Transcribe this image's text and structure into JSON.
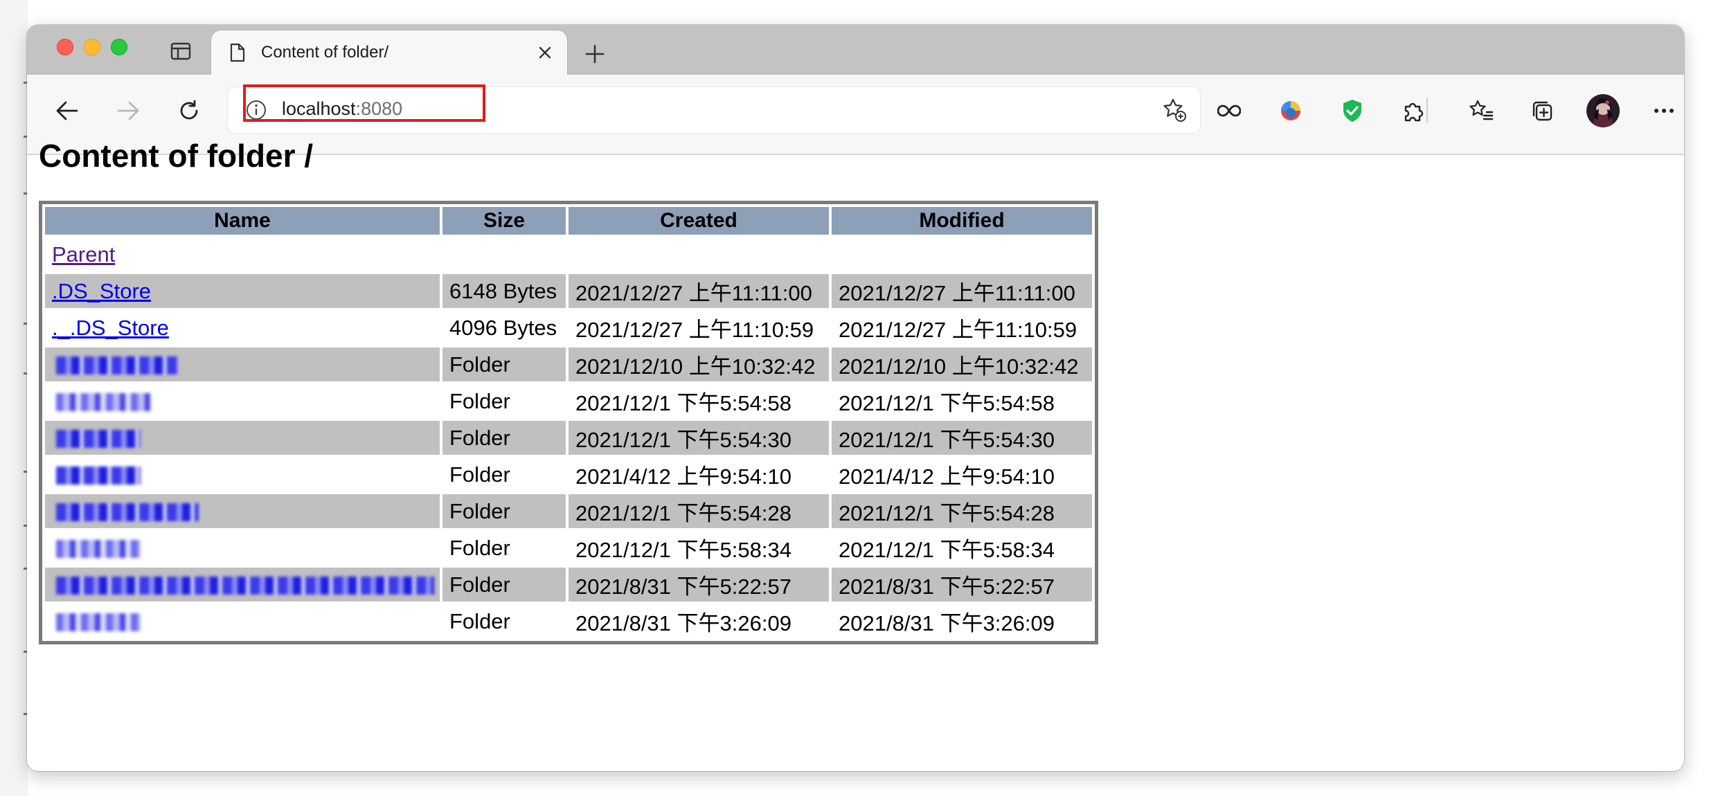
{
  "browser": {
    "tab": {
      "title": "Content of folder/"
    },
    "address": {
      "host": "localhost",
      "port": ":8080"
    }
  },
  "page": {
    "heading": "Content of folder /",
    "table": {
      "headers": [
        "Name",
        "Size",
        "Created",
        "Modified"
      ],
      "parent_link": "Parent",
      "rows": [
        {
          "name": ".DS_Store",
          "size": "6148 Bytes",
          "created": "2021/12/27 上午11:11:00",
          "modified": "2021/12/27 上午11:11:00"
        },
        {
          "name": "._.DS_Store",
          "size": "4096 Bytes",
          "created": "2021/12/27 上午11:10:59",
          "modified": "2021/12/27 上午11:10:59"
        },
        {
          "name": "",
          "size": "Folder",
          "created": "2021/12/10 上午10:32:42",
          "modified": "2021/12/10 上午10:32:42"
        },
        {
          "name": "",
          "size": "Folder",
          "created": "2021/12/1 下午5:54:58",
          "modified": "2021/12/1 下午5:54:58"
        },
        {
          "name": "",
          "size": "Folder",
          "created": "2021/12/1 下午5:54:30",
          "modified": "2021/12/1 下午5:54:30"
        },
        {
          "name": "",
          "size": "Folder",
          "created": "2021/4/12 上午9:54:10",
          "modified": "2021/4/12 上午9:54:10"
        },
        {
          "name": "",
          "size": "Folder",
          "created": "2021/12/1 下午5:54:28",
          "modified": "2021/12/1 下午5:54:28"
        },
        {
          "name": "",
          "size": "Folder",
          "created": "2021/12/1 下午5:58:34",
          "modified": "2021/12/1 下午5:58:34"
        },
        {
          "name": "",
          "size": "Folder",
          "created": "2021/8/31 下午5:22:57",
          "modified": "2021/8/31 下午5:22:57"
        },
        {
          "name": "",
          "size": "Folder",
          "created": "2021/8/31 下午3:26:09",
          "modified": "2021/8/31 下午3:26:09"
        }
      ]
    }
  },
  "colors": {
    "header_bg": "#8e9fb8",
    "row_shade": "#c0c0c0",
    "link": "#0000ee",
    "visited_link": "#551a8b",
    "highlight": "#e21b1b"
  },
  "icons": [
    "tab-actions-icon",
    "page-icon",
    "close-icon",
    "plus-icon",
    "back-arrow-icon",
    "forward-arrow-icon",
    "refresh-icon",
    "info-icon",
    "star-add-icon",
    "infinity-icon",
    "extension-palette-icon",
    "shield-check-icon",
    "puzzle-icon",
    "favorites-icon",
    "collections-icon",
    "avatar",
    "more-icon"
  ]
}
